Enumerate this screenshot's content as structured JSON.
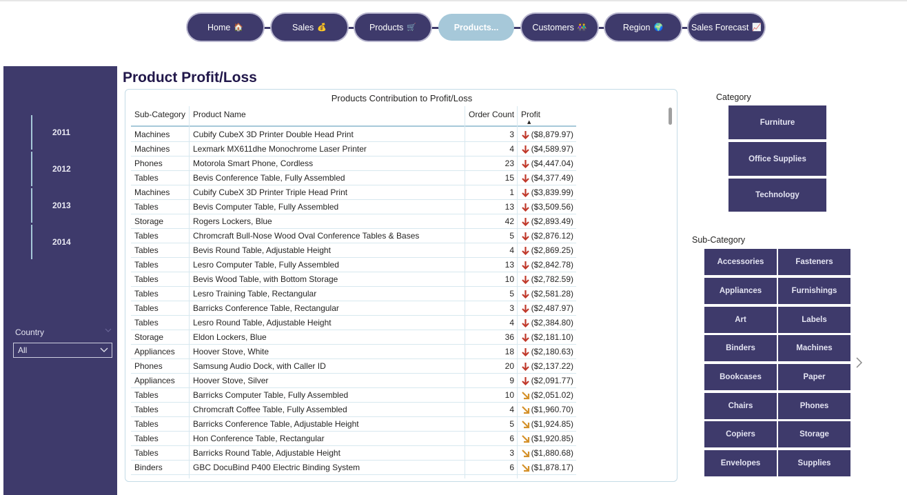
{
  "nav": [
    {
      "label": "Home",
      "emoji": "🏠"
    },
    {
      "label": "Sales",
      "emoji": "💰"
    },
    {
      "label": "Products",
      "emoji": "🛒"
    },
    {
      "label": "Products...",
      "emoji": ""
    },
    {
      "label": "Customers",
      "emoji": "👫"
    },
    {
      "label": "Region",
      "emoji": "🌍"
    },
    {
      "label": "Sales Forecast",
      "emoji": "📈"
    }
  ],
  "years": [
    "2011",
    "2012",
    "2013",
    "2014"
  ],
  "country": {
    "label": "Country",
    "value": "All"
  },
  "page_title": "Product Profit/Loss",
  "table": {
    "title": "Products Contribution to Profit/Loss",
    "headers": [
      "Sub-Category",
      "Product Name",
      "Order Count",
      "Profit"
    ],
    "rows": [
      [
        "Machines",
        "Cubify CubeX 3D Printer Double Head Print",
        "3",
        "($8,879.97)",
        "down"
      ],
      [
        "Machines",
        "Lexmark MX611dhe Monochrome Laser Printer",
        "4",
        "($4,589.97)",
        "down"
      ],
      [
        "Phones",
        "Motorola Smart Phone, Cordless",
        "23",
        "($4,447.04)",
        "down"
      ],
      [
        "Tables",
        "Bevis Conference Table, Fully Assembled",
        "15",
        "($4,377.49)",
        "down"
      ],
      [
        "Machines",
        "Cubify CubeX 3D Printer Triple Head Print",
        "1",
        "($3,839.99)",
        "down"
      ],
      [
        "Tables",
        "Bevis Computer Table, Fully Assembled",
        "13",
        "($3,509.56)",
        "down"
      ],
      [
        "Storage",
        "Rogers Lockers, Blue",
        "42",
        "($2,893.49)",
        "down"
      ],
      [
        "Tables",
        "Chromcraft Bull-Nose Wood Oval Conference Tables & Bases",
        "5",
        "($2,876.12)",
        "down"
      ],
      [
        "Tables",
        "Bevis Round Table, Adjustable Height",
        "4",
        "($2,869.25)",
        "down"
      ],
      [
        "Tables",
        "Lesro Computer Table, Fully Assembled",
        "13",
        "($2,842.78)",
        "down"
      ],
      [
        "Tables",
        "Bevis Wood Table, with Bottom Storage",
        "10",
        "($2,782.59)",
        "down"
      ],
      [
        "Tables",
        "Lesro Training Table, Rectangular",
        "5",
        "($2,581.28)",
        "down"
      ],
      [
        "Tables",
        "Barricks Conference Table, Rectangular",
        "3",
        "($2,487.97)",
        "down"
      ],
      [
        "Tables",
        "Lesro Round Table, Adjustable Height",
        "4",
        "($2,384.80)",
        "down"
      ],
      [
        "Storage",
        "Eldon Lockers, Blue",
        "36",
        "($2,181.10)",
        "down"
      ],
      [
        "Appliances",
        "Hoover Stove, White",
        "18",
        "($2,180.63)",
        "down"
      ],
      [
        "Phones",
        "Samsung Audio Dock, with Caller ID",
        "20",
        "($2,137.22)",
        "down"
      ],
      [
        "Appliances",
        "Hoover Stove, Silver",
        "9",
        "($2,091.77)",
        "down"
      ],
      [
        "Tables",
        "Barricks Computer Table, Fully Assembled",
        "10",
        "($2,051.02)",
        "diag"
      ],
      [
        "Tables",
        "Chromcraft Coffee Table, Fully Assembled",
        "4",
        "($1,960.70)",
        "diag"
      ],
      [
        "Tables",
        "Barricks Conference Table, Adjustable Height",
        "5",
        "($1,924.85)",
        "diag"
      ],
      [
        "Tables",
        "Hon Conference Table, Rectangular",
        "6",
        "($1,920.85)",
        "diag"
      ],
      [
        "Tables",
        "Barricks Round Table, Adjustable Height",
        "3",
        "($1,880.68)",
        "diag"
      ],
      [
        "Binders",
        "GBC DocuBind P400 Electric Binding System",
        "6",
        "($1,878.17)",
        "diag"
      ]
    ]
  },
  "category": {
    "title": "Category",
    "items": [
      "Furniture",
      "Office Supplies",
      "Technology"
    ]
  },
  "subcategory": {
    "title": "Sub-Category",
    "items": [
      "Accessories",
      "Fasteners",
      "Appliances",
      "Furnishings",
      "Art",
      "Labels",
      "Binders",
      "Machines",
      "Bookcases",
      "Paper",
      "Chairs",
      "Phones",
      "Copiers",
      "Storage",
      "Envelopes",
      "Supplies"
    ]
  },
  "colors": {
    "panel": "#3e3a6b",
    "active_tab": "#a6c8d9",
    "arrow_down": "#c0392b",
    "arrow_diag": "#d4912a"
  }
}
